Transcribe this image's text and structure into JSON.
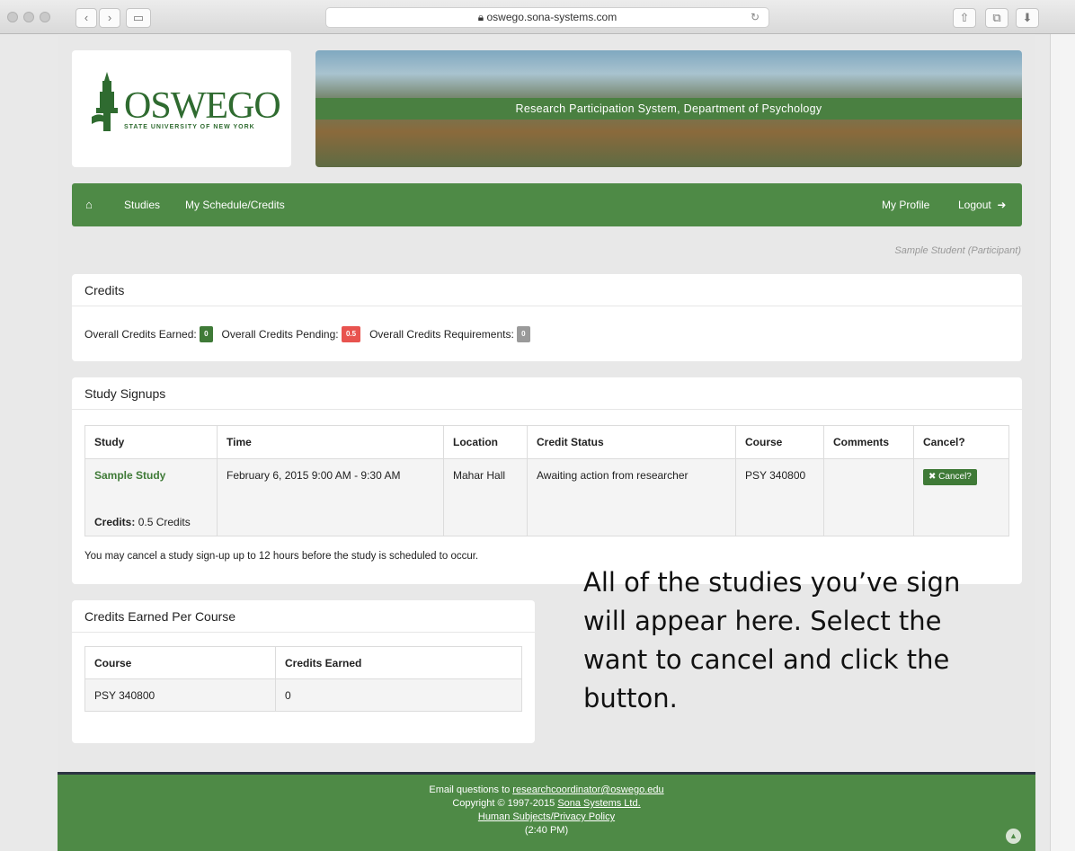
{
  "browser": {
    "url": "oswego.sona-systems.com"
  },
  "header": {
    "logo_text": "OSWEGO",
    "logo_sub": "STATE UNIVERSITY OF NEW YORK",
    "banner_title": "Research Participation System, Department of Psychology"
  },
  "nav": {
    "home_icon": "home-icon",
    "studies": "Studies",
    "schedule": "My Schedule/Credits",
    "profile": "My Profile",
    "logout": "Logout"
  },
  "user": {
    "identity": "Sample Student (Participant)"
  },
  "credits_panel": {
    "title": "Credits",
    "earned_label": "Overall Credits Earned:",
    "earned_value": "0",
    "pending_label": "Overall Credits Pending:",
    "pending_value": "0.5",
    "requirements_label": "Overall Credits Requirements:",
    "requirements_value": "0",
    "colors": {
      "earned": "#3f7a37",
      "pending": "#e8534f",
      "requirements": "#9a9a9a"
    }
  },
  "signups_panel": {
    "title": "Study Signups",
    "headers": [
      "Study",
      "Time",
      "Location",
      "Credit Status",
      "Course",
      "Comments",
      "Cancel?"
    ],
    "row": {
      "study": "Sample Study",
      "credits_label": "Credits:",
      "credits_value": "0.5 Credits",
      "time": "February 6, 2015 9:00 AM - 9:30 AM",
      "location": "Mahar Hall",
      "credit_status": "Awaiting action from researcher",
      "course": "PSY 340800",
      "comments": "",
      "cancel_label": "Cancel?"
    },
    "note": "You may cancel a study sign-up up to 12 hours before the study is scheduled to occur."
  },
  "per_course_panel": {
    "title": "Credits Earned Per Course",
    "headers": [
      "Course",
      "Credits Earned"
    ],
    "row": {
      "course": "PSY 340800",
      "credits": "0"
    }
  },
  "annotation": {
    "line1": "All of the studies you’ve sign",
    "line2": "will appear here. Select the",
    "line3": "want to cancel and click the",
    "line4": "button."
  },
  "footer": {
    "email_prefix": "Email questions to ",
    "email": "researchcoordinator@oswego.edu",
    "copyright_prefix": "Copyright © 1997-2015 ",
    "company": "Sona Systems Ltd.",
    "policy": "Human Subjects/Privacy Policy",
    "time": "(2:40 PM)"
  },
  "accent_color": "#4e8a46"
}
